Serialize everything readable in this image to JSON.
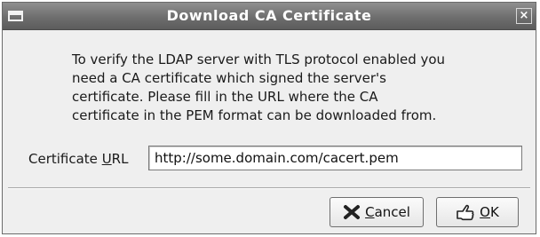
{
  "window": {
    "title": "Download CA Certificate",
    "close_glyph": "×"
  },
  "dialog": {
    "message": "To verify the LDAP server with TLS protocol enabled you\nneed a CA certificate which signed the server's\ncertificate. Please fill in the URL where the CA\ncertificate in the PEM format can be downloaded from.",
    "field": {
      "label": "Certificate URL",
      "mnemonic": "U",
      "value": "http://some.domain.com/cacert.pem"
    }
  },
  "buttons": {
    "cancel": {
      "label": "Cancel",
      "mnemonic": "C",
      "icon": "cancel-x-icon"
    },
    "ok": {
      "label": "OK",
      "mnemonic": "O",
      "icon": "ok-hand-icon"
    }
  }
}
